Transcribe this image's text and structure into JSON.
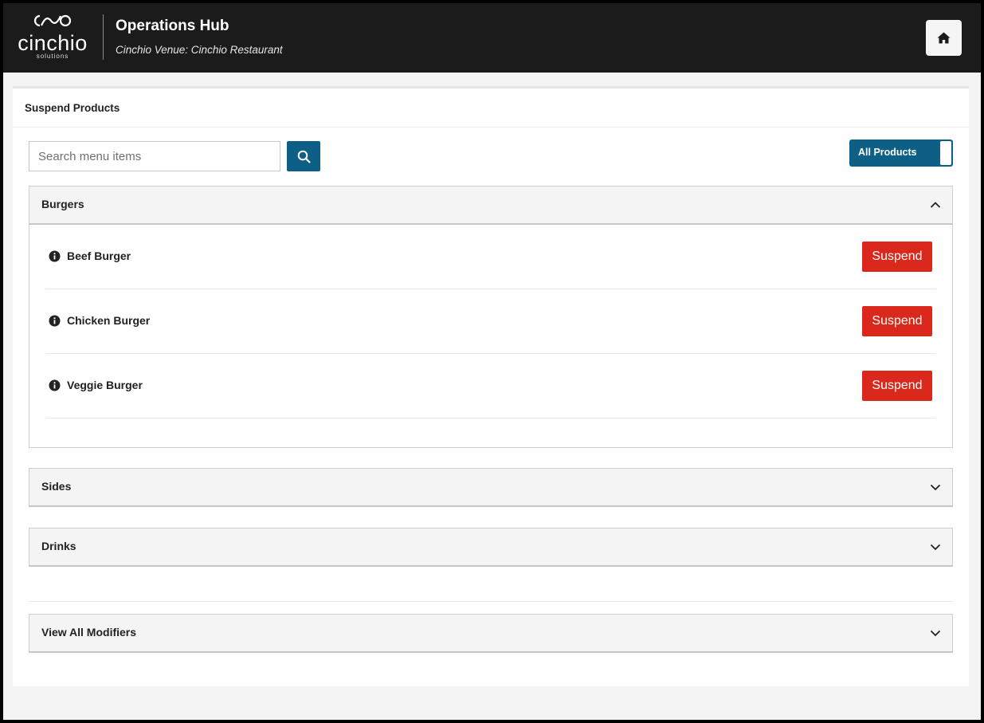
{
  "header": {
    "logo_text": "cinchio",
    "logo_subtext": "solutions",
    "app_title": "Operations Hub",
    "venue": "Cinchio Venue: Cinchio Restaurant"
  },
  "panel": {
    "title": "Suspend Products",
    "search": {
      "placeholder": "Search menu items",
      "value": ""
    },
    "toggle": {
      "label": "All Products",
      "on": true
    }
  },
  "categories": [
    {
      "title": "Burgers",
      "expanded": true,
      "items": [
        {
          "name": "Beef Burger",
          "action": "Suspend"
        },
        {
          "name": "Chicken Burger",
          "action": "Suspend"
        },
        {
          "name": "Veggie Burger",
          "action": "Suspend"
        }
      ]
    },
    {
      "title": "Sides",
      "expanded": false
    },
    {
      "title": "Drinks",
      "expanded": false
    }
  ],
  "modifiers": {
    "title": "View All Modifiers",
    "expanded": false
  },
  "colors": {
    "header_bg": "#1b1b1b",
    "accent": "#0e5f86",
    "suspend": "#da291c"
  }
}
